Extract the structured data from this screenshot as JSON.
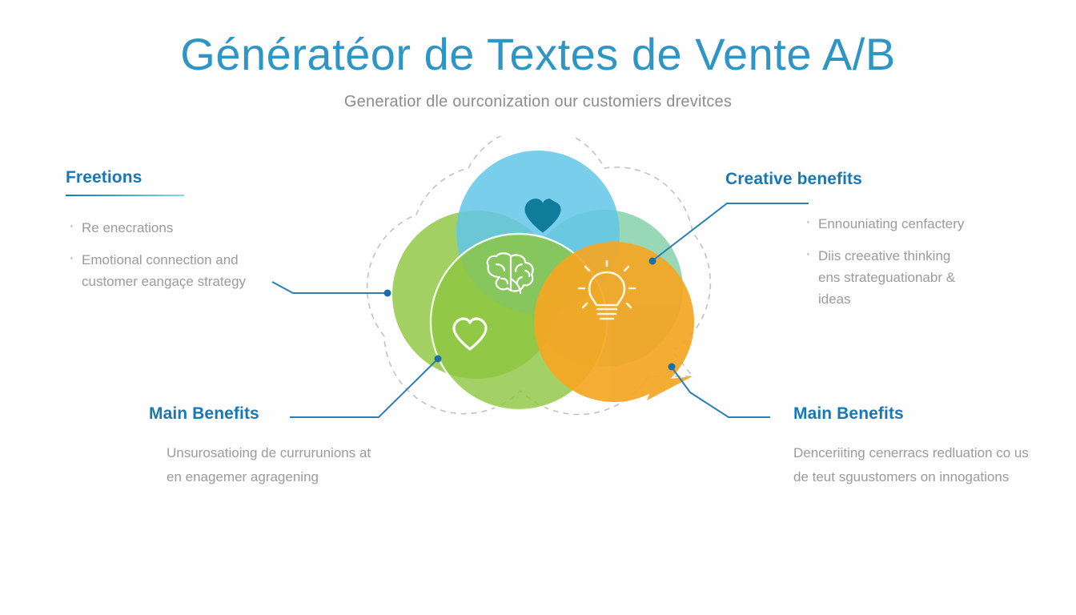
{
  "header": {
    "title": "Génératéor de Textes de Vente A/B",
    "subtitle": "Generatior dle ourconization our customiers drevitces",
    "title_color": "#2E95C4",
    "subtitle_color": "#8d8d8d"
  },
  "blocks": {
    "top_left": {
      "heading": "Freetions",
      "bullets": [
        "Re enecrations",
        "Emotional connection and customer eangaçe strategy"
      ]
    },
    "top_right": {
      "heading": "Creative benefits",
      "bullets": [
        "Ennouniating cenfactery",
        "Diis creeative thinking ens strateguationabr & ideas"
      ]
    },
    "bottom_left": {
      "heading": "Main Benefits",
      "text": "Unsurosatioing de currurunions at en enagemer agragening"
    },
    "bottom_right": {
      "heading": "Main Benefits",
      "text": "Denceriiting cenerracs redluation co us de teut sguustomers on innogations"
    }
  },
  "diagram": {
    "type": "venn-overlap",
    "shapes": [
      {
        "name": "blue-circle",
        "color": "#7DCDEA"
      },
      {
        "name": "green-circle-left",
        "color": "#8DC63F"
      },
      {
        "name": "green-circle-right",
        "color": "#8FD49B"
      },
      {
        "name": "green-circle-lower",
        "color": "#8DC63F"
      },
      {
        "name": "orange-speech-bubble",
        "color": "#F5A623"
      }
    ],
    "icons": [
      {
        "name": "heart-filled-icon",
        "color": "#0F7C9C"
      },
      {
        "name": "brain-outline-icon",
        "color": "#ffffff"
      },
      {
        "name": "heart-outline-icon",
        "color": "#ffffff"
      },
      {
        "name": "lightbulb-outline-icon",
        "color": "#ffffff"
      }
    ],
    "outline": {
      "name": "dashed-outline",
      "color": "#b8b8b8",
      "style": "dashed"
    },
    "connector_color": "#1B6FA8"
  }
}
